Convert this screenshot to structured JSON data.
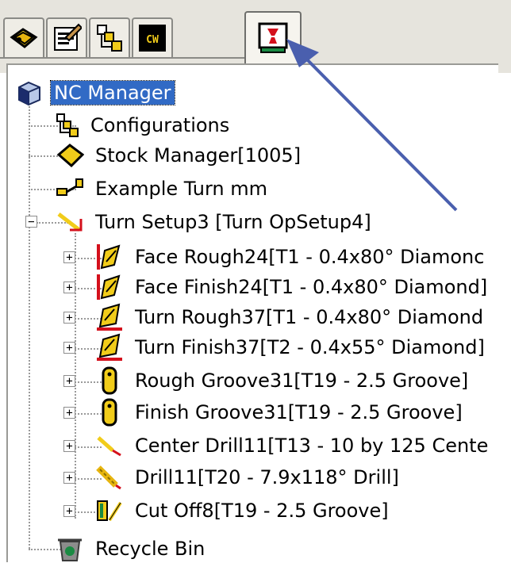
{
  "tabs": [
    {
      "icon": "feature-manager-icon"
    },
    {
      "icon": "property-manager-icon"
    },
    {
      "icon": "configuration-manager-icon"
    },
    {
      "icon": "camworks-icon",
      "text": "CW"
    },
    {
      "icon": "nc-manager-icon",
      "active": true
    }
  ],
  "tree": {
    "root": {
      "label": "NC Manager",
      "icon": "nc-manager-cube-icon",
      "selected": true
    },
    "configurations": {
      "label": "Configurations",
      "icon": "configurations-icon"
    },
    "stock_manager": {
      "label": "Stock Manager[1005]",
      "icon": "stock-manager-icon"
    },
    "example_turn": {
      "label": "Example Turn mm",
      "icon": "machine-icon"
    },
    "setup": {
      "label": "Turn Setup3 [Turn OpSetup4]",
      "icon": "setup-arrow-icon",
      "operations": [
        {
          "label": "Face Rough24[T1 - 0.4x80° Diamonc",
          "icon": "face-rough-icon"
        },
        {
          "label": "Face Finish24[T1 - 0.4x80° Diamond]",
          "icon": "face-finish-icon"
        },
        {
          "label": "Turn Rough37[T1 - 0.4x80° Diamond",
          "icon": "turn-rough-icon"
        },
        {
          "label": "Turn Finish37[T2 - 0.4x55° Diamond]",
          "icon": "turn-finish-icon"
        },
        {
          "label": "Rough Groove31[T19 - 2.5 Groove]",
          "icon": "groove-rough-icon"
        },
        {
          "label": "Finish Groove31[T19 - 2.5 Groove]",
          "icon": "groove-finish-icon"
        },
        {
          "label": "Center Drill11[T13 - 10 by 125 Cente",
          "icon": "center-drill-icon"
        },
        {
          "label": "Drill11[T20 - 7.9x118° Drill]",
          "icon": "drill-icon"
        },
        {
          "label": "Cut Off8[T19 - 2.5 Groove]",
          "icon": "cut-off-icon"
        }
      ]
    },
    "recycle_bin": {
      "label": "Recycle Bin",
      "icon": "recycle-bin-icon"
    }
  },
  "colors": {
    "selection": "#316ac5",
    "arrow": "#4a5fae",
    "accent_red": "#d4101c",
    "icon_yellow": "#f1cc1a"
  }
}
